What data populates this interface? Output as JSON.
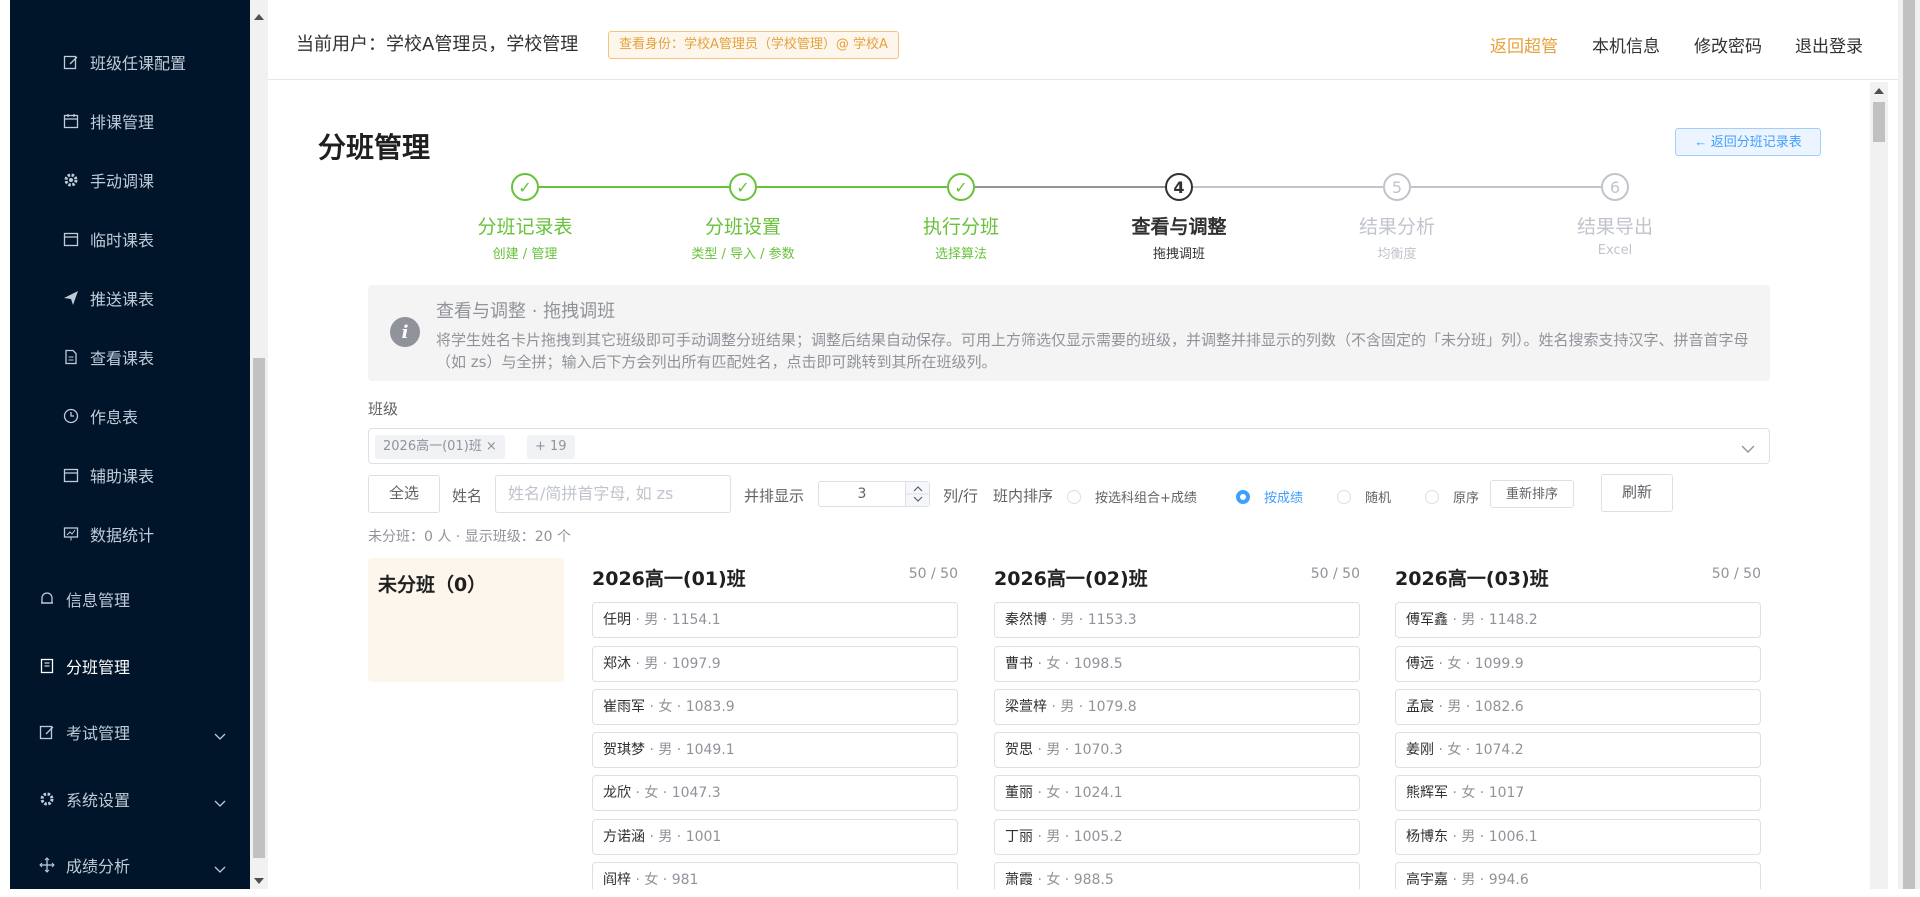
{
  "sidebar": {
    "items": [
      {
        "label": "班级任课配置",
        "icon": "edit-icon"
      },
      {
        "label": "排课管理",
        "icon": "calendar-icon"
      },
      {
        "label": "手动调课",
        "icon": "gear-icon"
      },
      {
        "label": "临时课表",
        "icon": "calendar-icon"
      },
      {
        "label": "推送课表",
        "icon": "send-icon"
      },
      {
        "label": "查看课表",
        "icon": "document-icon"
      },
      {
        "label": "作息表",
        "icon": "clock-icon"
      },
      {
        "label": "辅助课表",
        "icon": "calendar-icon"
      },
      {
        "label": "数据统计",
        "icon": "chart-icon"
      }
    ],
    "groups": [
      {
        "label": "信息管理",
        "icon": "bell-icon"
      },
      {
        "label": "分班管理",
        "icon": "building-icon"
      },
      {
        "label": "考试管理",
        "icon": "edit-icon"
      },
      {
        "label": "系统设置",
        "icon": "gear-icon"
      },
      {
        "label": "成绩分析",
        "icon": "move-icon"
      }
    ]
  },
  "header": {
    "user": "当前用户：学校A管理员，学校管理",
    "role_tag": "查看身份：学校A管理员（学校管理）@ 学校A",
    "links": [
      "返回超管",
      "本机信息",
      "修改密码",
      "退出登录"
    ],
    "accent_color": "#e6a23c"
  },
  "page": {
    "title": "分班管理",
    "back_button": "← 返回分班记录表"
  },
  "steps": [
    {
      "num": "✓",
      "title": "分班记录表",
      "desc": "创建 / 管理",
      "state": "done"
    },
    {
      "num": "✓",
      "title": "分班设置",
      "desc": "类型 / 导入 / 参数",
      "state": "done"
    },
    {
      "num": "✓",
      "title": "执行分班",
      "desc": "选择算法",
      "state": "done"
    },
    {
      "num": "4",
      "title": "查看与调整",
      "desc": "拖拽调班",
      "state": "active"
    },
    {
      "num": "5",
      "title": "结果分析",
      "desc": "均衡度",
      "state": "wait"
    },
    {
      "num": "6",
      "title": "结果导出",
      "desc": "Excel",
      "state": "wait"
    }
  ],
  "info": {
    "title": "查看与调整 · 拖拽调班",
    "desc": "将学生姓名卡片拖拽到其它班级即可手动调整分班结果；调整后结果自动保存。可用上方筛选仅显示需要的班级，并调整并排显示的列数（不含固定的「未分班」列）。姓名搜索支持汉字、拼音首字母（如 zs）与全拼；输入后下方会列出所有匹配姓名，点击即可跳转到其所在班级列。"
  },
  "filter": {
    "class_label": "班级",
    "chips": [
      "2026高一(01)班 ×",
      "+ 19"
    ],
    "select_all": "全选",
    "name_label": "姓名",
    "name_placeholder": "姓名/简拼首字母, 如 zs",
    "cols_label": "并排显示",
    "cols_value": "3",
    "cols_unit": "列/行",
    "sort_label": "班内排序",
    "sort_options": [
      "按选科组合+成绩",
      "按成绩",
      "随机",
      "原序"
    ],
    "sort_selected": "按成绩",
    "resort": "重新排序",
    "refresh": "刷新",
    "stat": "未分班：0 人 · 显示班级：20 个"
  },
  "unassigned": {
    "title": "未分班（0）"
  },
  "classes": [
    {
      "name": "2026高一(01)班",
      "count": "50 / 50",
      "students": [
        {
          "name": "任明",
          "meta": " · 男 · 1154.1"
        },
        {
          "name": "郑沐",
          "meta": " · 男 · 1097.9"
        },
        {
          "name": "崔雨军",
          "meta": " · 女 · 1083.9"
        },
        {
          "name": "贺琪梦",
          "meta": " · 男 · 1049.1"
        },
        {
          "name": "龙欣",
          "meta": " · 女 · 1047.3"
        },
        {
          "name": "方诺涵",
          "meta": " · 男 · 1001"
        },
        {
          "name": "阎梓",
          "meta": " · 女 · 981"
        }
      ]
    },
    {
      "name": "2026高一(02)班",
      "count": "50 / 50",
      "students": [
        {
          "name": "秦然博",
          "meta": " · 男 · 1153.3"
        },
        {
          "name": "曹书",
          "meta": " · 女 · 1098.5"
        },
        {
          "name": "梁萱梓",
          "meta": " · 男 · 1079.8"
        },
        {
          "name": "贺思",
          "meta": " · 男 · 1070.3"
        },
        {
          "name": "董丽",
          "meta": " · 女 · 1024.1"
        },
        {
          "name": "丁丽",
          "meta": " · 男 · 1005.2"
        },
        {
          "name": "萧霞",
          "meta": " · 女 · 988.5"
        }
      ]
    },
    {
      "name": "2026高一(03)班",
      "count": "50 / 50",
      "students": [
        {
          "name": "傅军鑫",
          "meta": " · 男 · 1148.2"
        },
        {
          "name": "傅远",
          "meta": " · 女 · 1099.9"
        },
        {
          "name": "孟宸",
          "meta": " · 男 · 1082.6"
        },
        {
          "name": "姜刚",
          "meta": " · 女 · 1074.2"
        },
        {
          "name": "熊辉军",
          "meta": " · 女 · 1017"
        },
        {
          "name": "杨博东",
          "meta": " · 男 · 1006.1"
        },
        {
          "name": "高宇嘉",
          "meta": " · 男 · 994.6"
        }
      ]
    }
  ],
  "colors": {
    "done": "#67c23a",
    "active": "#303133",
    "wait": "#c0c4cc",
    "primary": "#409eff"
  }
}
